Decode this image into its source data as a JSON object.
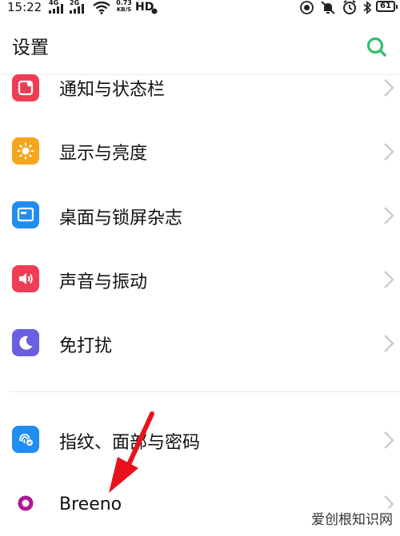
{
  "status_bar": {
    "time": "15:22",
    "sim1": "4G",
    "sim2": "2G",
    "net_speed_value": "0.73",
    "net_speed_unit": "KB/S",
    "hd": "HD",
    "battery": "61"
  },
  "header": {
    "title": "设置",
    "search_icon": "search-icon",
    "accent": "#2fbf71"
  },
  "settings_items": [
    {
      "label": "通知与状态栏",
      "icon": "notification-icon",
      "color": "#ef3d55"
    },
    {
      "label": "显示与亮度",
      "icon": "brightness-icon",
      "color": "#f5a51e"
    },
    {
      "label": "桌面与锁屏杂志",
      "icon": "wallpaper-icon",
      "color": "#1f8ef0"
    },
    {
      "label": "声音与振动",
      "icon": "volume-icon",
      "color": "#ef3d55"
    },
    {
      "label": "免打扰",
      "icon": "moon-icon",
      "color": "#6a5fe0"
    },
    {
      "label": "指纹、面部与密码",
      "icon": "fingerprint-face-icon",
      "color": "#1f8ef0"
    },
    {
      "label": "Breeno",
      "icon": "breeno-icon",
      "color": "#b3168f"
    }
  ],
  "watermark": "爱创根知识网"
}
